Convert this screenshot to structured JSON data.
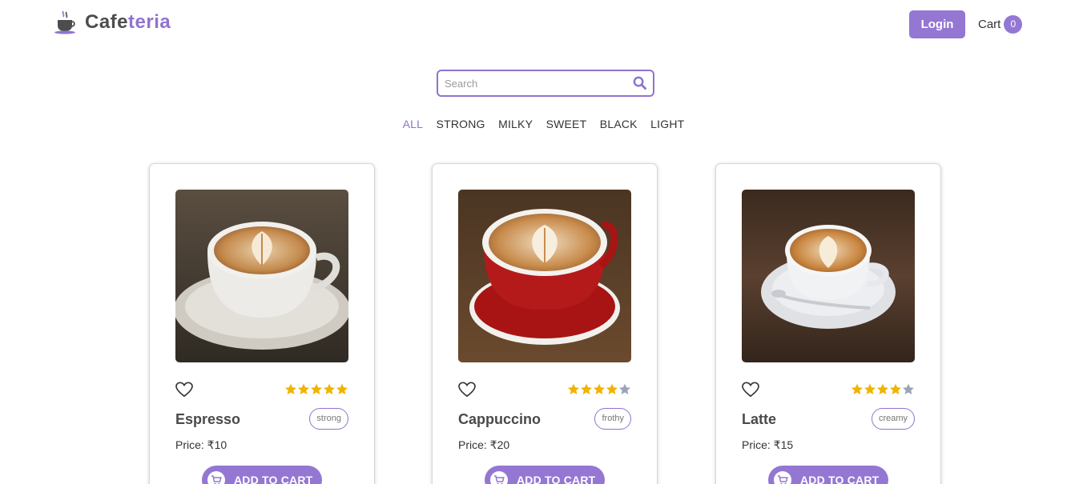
{
  "brand": {
    "name_part1": "Cafe",
    "name_part2": "teria",
    "logo_icon": "coffee-cup-icon"
  },
  "header": {
    "login_label": "Login",
    "cart_label": "Cart",
    "cart_count": "0"
  },
  "search": {
    "placeholder": "Search",
    "value": "",
    "icon": "search-icon"
  },
  "filters": [
    {
      "label": "ALL",
      "active": true
    },
    {
      "label": "STRONG",
      "active": false
    },
    {
      "label": "MILKY",
      "active": false
    },
    {
      "label": "SWEET",
      "active": false
    },
    {
      "label": "BLACK",
      "active": false
    },
    {
      "label": "LIGHT",
      "active": false
    }
  ],
  "colors": {
    "accent": "#9477d3",
    "star_filled": "#f0b400",
    "star_empty": "#9aa5b8"
  },
  "products": [
    {
      "name": "Espresso",
      "tag": "strong",
      "price": "Price: ₹10",
      "rating": 5,
      "add_label": "ADD TO CART",
      "cup_color": "white"
    },
    {
      "name": "Cappuccino",
      "tag": "frothy",
      "price": "Price: ₹20",
      "rating": 4,
      "add_label": "ADD TO CART",
      "cup_color": "red"
    },
    {
      "name": "Latte",
      "tag": "creamy",
      "price": "Price: ₹15",
      "rating": 4,
      "add_label": "ADD TO CART",
      "cup_color": "white"
    }
  ]
}
